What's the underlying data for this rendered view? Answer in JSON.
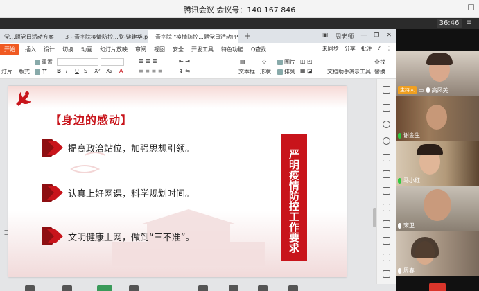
{
  "meeting": {
    "title": "腾讯会议 会议号：140 167 846",
    "timer": "36:46"
  },
  "wps": {
    "tabs": [
      {
        "label": "党...题党日活动方案",
        "icon_color": "#2e6bd6",
        "active": false
      },
      {
        "label": "3 - 青字院疫情防控...欣-饶建华.pdf",
        "icon_color": "#d9352b",
        "active": false
      },
      {
        "label": "青字院 \"疫情防控...题党日活动PPT",
        "icon_color": "#f05a22",
        "active": true
      }
    ],
    "tab_add": "+",
    "user_name": "周老师",
    "menu": {
      "start": "开始",
      "items": [
        "插入",
        "设计",
        "切换",
        "动画",
        "幻灯片放映",
        "审阅",
        "视图",
        "安全",
        "开发工具",
        "特色功能"
      ],
      "search": "Q查找",
      "right": [
        "未同步",
        "分享",
        "批注"
      ]
    },
    "ribbon": {
      "left_labels": [
        "灯片",
        "版式",
        "重置",
        "节"
      ],
      "right_labels": [
        "文本框",
        "形状",
        "图片",
        "排列",
        "文档助手",
        "演示工具",
        "查找",
        "替换"
      ]
    }
  },
  "slide": {
    "heading": "【身边的感动】",
    "bullets": [
      "提高政治站位，加强思想引领。",
      "认真上好网课，科学规划时间。",
      "文明健康上网，做到“三不准”。"
    ],
    "banner": "严明疫情防控工作要求"
  },
  "participants": [
    {
      "name": "高凤美",
      "role": "主持人",
      "mic_color": "#ffffff"
    },
    {
      "name": "谢金生",
      "role": "",
      "mic_color": "#2ecc40"
    },
    {
      "name": "马小红",
      "role": "",
      "mic_color": "#2ecc40"
    },
    {
      "name": "宋卫",
      "role": "",
      "mic_color": "#ffffff"
    },
    {
      "name": "周春",
      "role": "",
      "mic_color": "#ffffff"
    }
  ],
  "colors": {
    "accent": "#f05a22",
    "party_red": "#c8141b"
  }
}
